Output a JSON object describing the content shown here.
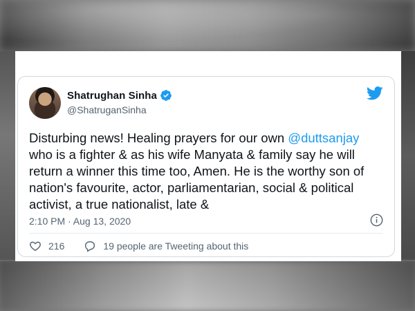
{
  "tweet": {
    "author_name": "Shatrughan Sinha",
    "author_handle": "@ShatruganSinha",
    "text_lines": [
      {
        "before": "Disturbing news! Healing prayers for our own ",
        "mention": " @duttsanjay"
      },
      {
        "text": "who is a fighter & as his wife Manyata & family say he will"
      },
      {
        "text": "return a winner this time too, Amen. He is the worthy son of"
      },
      {
        "text": "nation's favourite, actor, parliamentarian, social & political"
      },
      {
        "text": "activist, a true nationalist, late &"
      }
    ],
    "timestamp": "2:10 PM · Aug 13, 2020",
    "like_count": "216",
    "reply_label": "19 people are Tweeting about this"
  },
  "icons": {
    "verified": "verified-badge-icon",
    "brand": "twitter-bird-icon",
    "info": "info-icon",
    "like": "heart-icon",
    "reply": "comment-bubble-icon"
  },
  "colors": {
    "accent": "#1d9bf0",
    "text": "#0f1419",
    "secondary": "#536471"
  }
}
